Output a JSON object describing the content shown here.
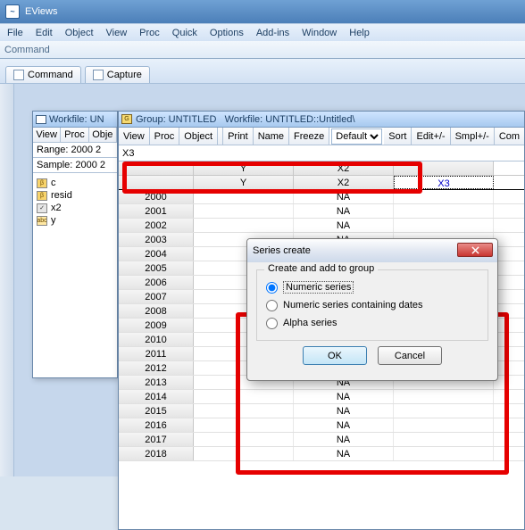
{
  "app": {
    "title": "EViews"
  },
  "menu": {
    "file": "File",
    "edit": "Edit",
    "object": "Object",
    "view": "View",
    "proc": "Proc",
    "quick": "Quick",
    "options": "Options",
    "addins": "Add-ins",
    "window": "Window",
    "help": "Help"
  },
  "command_label": "Command",
  "tabs": {
    "command": "Command",
    "capture": "Capture"
  },
  "workfile": {
    "title": "Workfile: UN",
    "toolbar": {
      "view": "View",
      "proc": "Proc",
      "object": "Obje"
    },
    "range": "Range: 2000 2",
    "sample": "Sample: 2000 2",
    "items": [
      {
        "icon": "β",
        "class": "ic-c",
        "name": "c"
      },
      {
        "icon": "β",
        "class": "ic-resid",
        "name": "resid"
      },
      {
        "icon": "✓",
        "class": "ic-x2",
        "name": "x2"
      },
      {
        "icon": "abc",
        "class": "ic-y",
        "name": "y"
      }
    ]
  },
  "group": {
    "title_prefix": "Group: UNTITLED",
    "title_suffix": "Workfile: UNTITLED::Untitled\\",
    "toolbar": {
      "view": "View",
      "proc": "Proc",
      "object": "Object",
      "print": "Print",
      "name": "Name",
      "freeze": "Freeze",
      "default": "Default",
      "sort": "Sort",
      "edit": "Edit+/-",
      "smpl": "Smpl+/-",
      "com": "Com"
    },
    "formula": "X3",
    "headers1": {
      "rowh": "",
      "c1": "Y",
      "c2": "X2",
      "c3": ""
    },
    "headers2": {
      "rowh": "",
      "c1": "Y",
      "c2": "X2",
      "c3": "X3"
    },
    "years": [
      "2000",
      "2001",
      "2002",
      "2003",
      "2004",
      "2005",
      "2006",
      "2007",
      "2008",
      "2009",
      "2010",
      "2011",
      "2012",
      "2013",
      "2014",
      "2015",
      "2016",
      "2017",
      "2018"
    ],
    "na": "NA"
  },
  "dialog": {
    "title": "Series create",
    "group_legend": "Create and add to group",
    "opt1": "Numeric series",
    "opt2": "Numeric series containing dates",
    "opt3": "Alpha series",
    "ok": "OK",
    "cancel": "Cancel"
  }
}
